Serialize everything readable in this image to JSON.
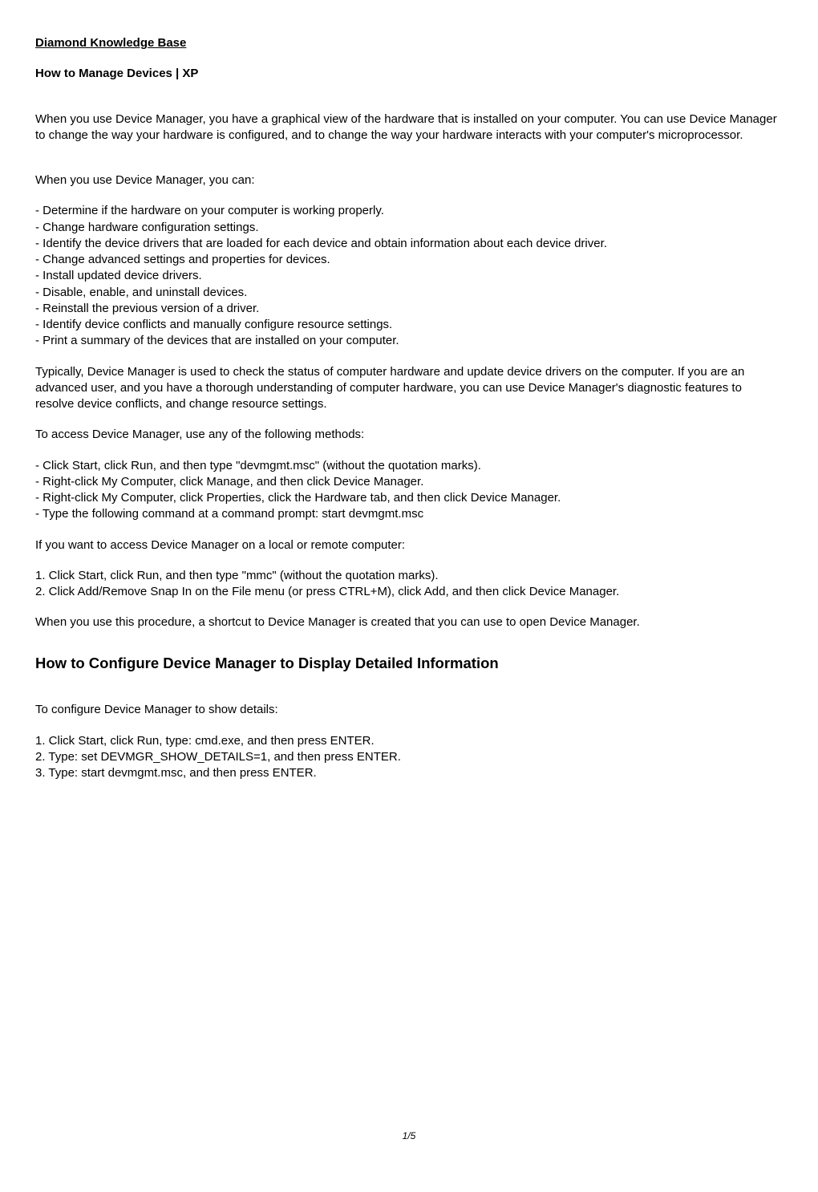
{
  "header": {
    "site_title": "Diamond Knowledge Base",
    "article_title": "How to Manage Devices | XP"
  },
  "intro": {
    "p1": "When you use Device Manager, you have a graphical view of the hardware that is installed on your computer. You can use Device Manager to change the way your hardware is configured, and to change the way your hardware interacts with your computer's microprocessor.",
    "p2": "When you use Device Manager, you can:"
  },
  "capabilities": {
    "items": [
      "- Determine if the hardware on your computer is working properly.",
      "- Change hardware configuration settings.",
      "- Identify the device drivers that are loaded for each device and obtain information about each device driver.",
      "- Change advanced settings and properties for devices.",
      "- Install updated device drivers.",
      "- Disable, enable, and uninstall devices.",
      "- Reinstall the previous version of a driver.",
      "- Identify device conflicts and manually configure resource settings.",
      "- Print a summary of the devices that are installed on your computer."
    ]
  },
  "usage": {
    "p1": "Typically, Device Manager is used to check the status of computer hardware and update device drivers on the computer. If you are an advanced user, and you have a thorough understanding of computer hardware, you can use Device Manager's diagnostic features to resolve device conflicts, and change resource settings.",
    "p2": "To access Device Manager, use any of the following methods:"
  },
  "access_methods": {
    "items": [
      "- Click Start, click Run, and then type \"devmgmt.msc\" (without the quotation marks).",
      "- Right-click My Computer, click Manage, and then click Device Manager.",
      "- Right-click My Computer, click Properties, click the Hardware tab, and then click Device Manager.",
      "- Type the following command at a command prompt:  start devmgmt.msc"
    ]
  },
  "remote": {
    "intro": "If you want to access Device Manager on a local or remote computer:",
    "step1": "1. Click Start, click Run, and then type \"mmc\" (without the quotation marks).",
    "step2": "2. Click Add/Remove Snap In on the File menu (or press CTRL+M), click Add, and then click Device Manager.",
    "outro": "When you use this procedure, a shortcut to Device Manager is created that you can use to open Device Manager."
  },
  "section2": {
    "heading": "How to Configure Device Manager to Display Detailed Information",
    "intro": "To configure Device Manager to show details:",
    "step1": "1. Click Start, click Run, type: cmd.exe, and then press ENTER.",
    "step2": "2. Type: set DEVMGR_SHOW_DETAILS=1, and then press ENTER.",
    "step3": "3. Type: start devmgmt.msc, and then press ENTER."
  },
  "footer": {
    "page_number": "1/5"
  }
}
